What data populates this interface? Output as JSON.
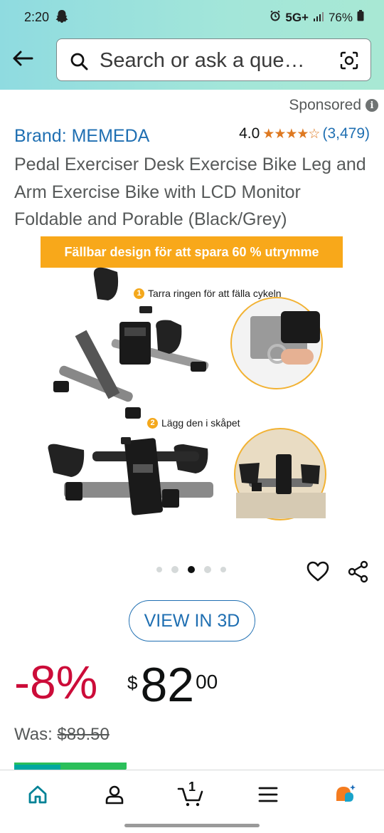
{
  "status_bar": {
    "time": "2:20",
    "network": "5G+",
    "battery": "76%"
  },
  "header": {
    "search_placeholder": "Search or ask a que…"
  },
  "product": {
    "sponsored_label": "Sponsored",
    "brand": "Brand: MEMEDA",
    "rating_value": "4.0",
    "rating_stars": 4.0,
    "rating_count": "(3,479)",
    "title": "Pedal Exerciser Desk Exercise Bike Leg and Arm Exercise Bike with LCD Monitor Foldable and Porable (Black/Grey)"
  },
  "image": {
    "banner": "Fällbar design för att spara 60 % utrymme",
    "step1_num": "1",
    "step1_text": "Tarra ringen för att fälla cykeln",
    "step2_num": "2",
    "step2_text": "Lägg den i skåpet",
    "carousel_count": 5,
    "carousel_active": 3
  },
  "actions": {
    "view3d_label": "VIEW IN 3D"
  },
  "price": {
    "discount": "-8%",
    "symbol": "$",
    "whole": "82",
    "fraction": "00",
    "was_label": "Was: ",
    "was_price": "$89.50"
  },
  "bottom_nav": {
    "cart_count": "1"
  },
  "colors": {
    "header_bg": "#a3e6d9",
    "link": "#1f6fb2",
    "discount": "#cc0c39",
    "star": "#de7921",
    "banner": "#f8a81a"
  }
}
